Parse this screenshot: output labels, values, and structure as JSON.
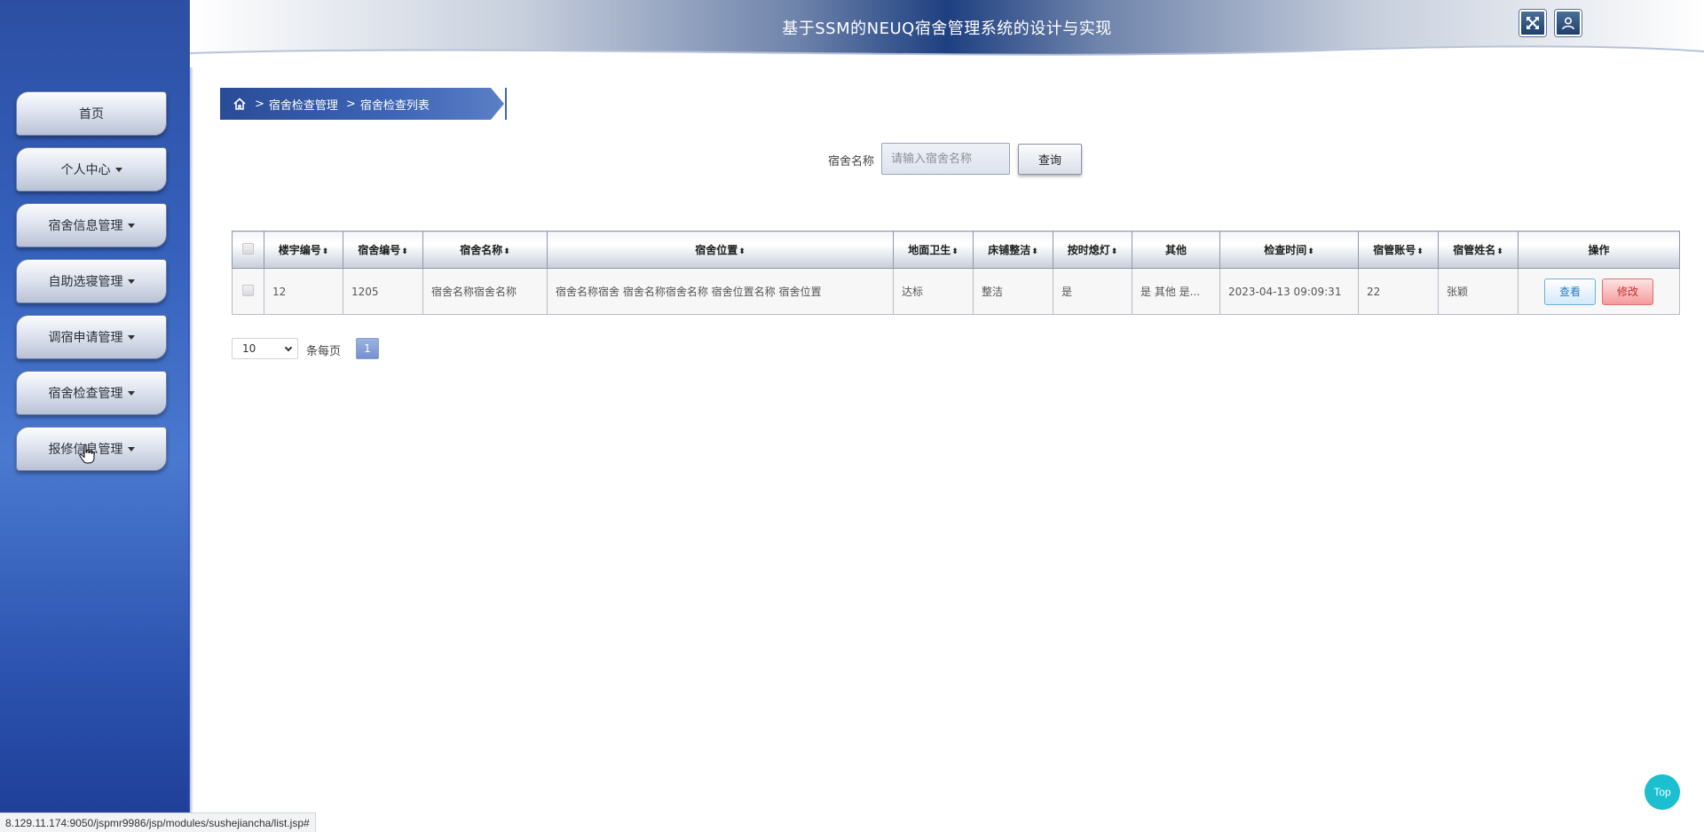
{
  "header": {
    "title": "基于SSM的NEUQ宿舍管理系统的设计与实现",
    "fullscreen_icon": "fullscreen-icon",
    "user_icon": "user-icon"
  },
  "sidebar": {
    "items": [
      {
        "label": "首页",
        "has_caret": false
      },
      {
        "label": "个人中心",
        "has_caret": true
      },
      {
        "label": "宿舍信息管理",
        "has_caret": true
      },
      {
        "label": "自助选寝管理",
        "has_caret": true
      },
      {
        "label": "调宿申请管理",
        "has_caret": true
      },
      {
        "label": "宿舍检查管理",
        "has_caret": true
      },
      {
        "label": "报修信息管理",
        "has_caret": true
      }
    ]
  },
  "breadcrumb": {
    "home_icon": "home-icon",
    "sep": ">",
    "level1": "宿舍检查管理",
    "level2": "宿舍检查列表"
  },
  "search": {
    "label": "宿舍名称",
    "placeholder": "请输入宿舍名称",
    "value": "",
    "button": "查询"
  },
  "table": {
    "headers": [
      "楼宇编号",
      "宿舍编号",
      "宿舍名称",
      "宿舍位置",
      "地面卫生",
      "床铺整洁",
      "按时熄灯",
      "其他",
      "检查时间",
      "宿管账号",
      "宿管姓名",
      "操作"
    ],
    "sort_glyph": "⬍",
    "rows": [
      {
        "building_no": "12",
        "room_no": "1205",
        "room_name": "宿舍名称宿舍名称",
        "location": "宿舍名称宿舍 宿舍名称宿舍名称 宿舍位置名称 宿舍位置",
        "floor_hygiene": "达标",
        "bed_tidy": "整洁",
        "lights_out": "是",
        "other": "是 其他 是...",
        "check_time": "2023-04-13 09:09:31",
        "manager_account": "22",
        "manager_name": "张颖",
        "view_label": "查看",
        "edit_label": "修改"
      }
    ]
  },
  "pagination": {
    "page_size": "10",
    "per_page_label": "条每页",
    "current_page": "1"
  },
  "status_bar": {
    "url": "8.129.11.174:9050/jspmr9986/jsp/modules/sushejiancha/list.jsp#"
  },
  "top_button": {
    "label": "Top",
    "color": "#1bbfcf"
  },
  "colors": {
    "sidebar": "#3561bd",
    "header_center": "#1e3f80",
    "breadcrumb": "#3d64b6"
  }
}
